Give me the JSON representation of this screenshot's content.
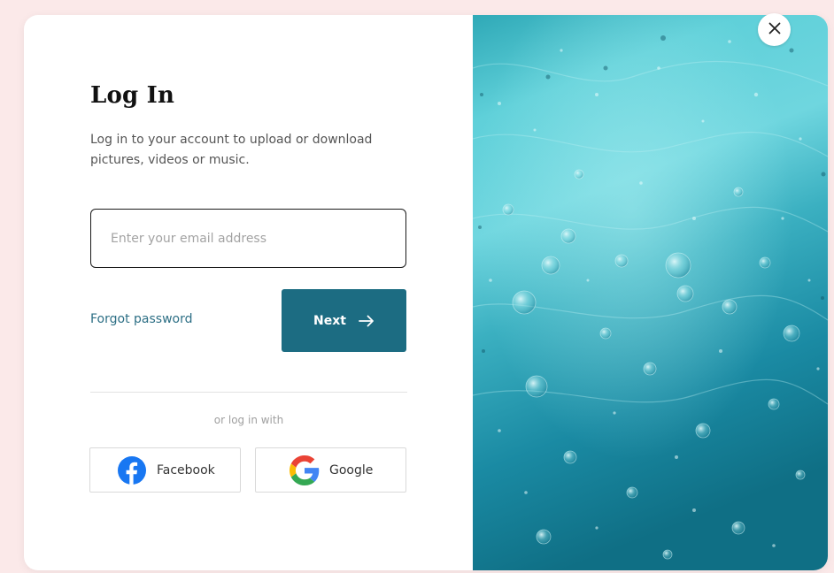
{
  "login": {
    "title": "Log In",
    "subtitle": "Log in to your account to upload or download pictures, videos or music.",
    "email": {
      "value": "",
      "placeholder": "Enter your email address"
    },
    "forgot_password": "Forgot password",
    "next_label": "Next",
    "divider_text": "or log in with",
    "social": {
      "facebook_label": "Facebook",
      "google_label": "Google"
    }
  },
  "icons": {
    "next": "arrow-right-icon",
    "facebook": "facebook-icon",
    "google": "google-icon",
    "close": "close-icon"
  },
  "colors": {
    "accent": "#1c6c82",
    "link": "#2d6f85",
    "facebook": "#1877f2",
    "background": "#fbe9e9",
    "water_light": "#5fd0d9",
    "water_dark": "#0f6f85"
  }
}
